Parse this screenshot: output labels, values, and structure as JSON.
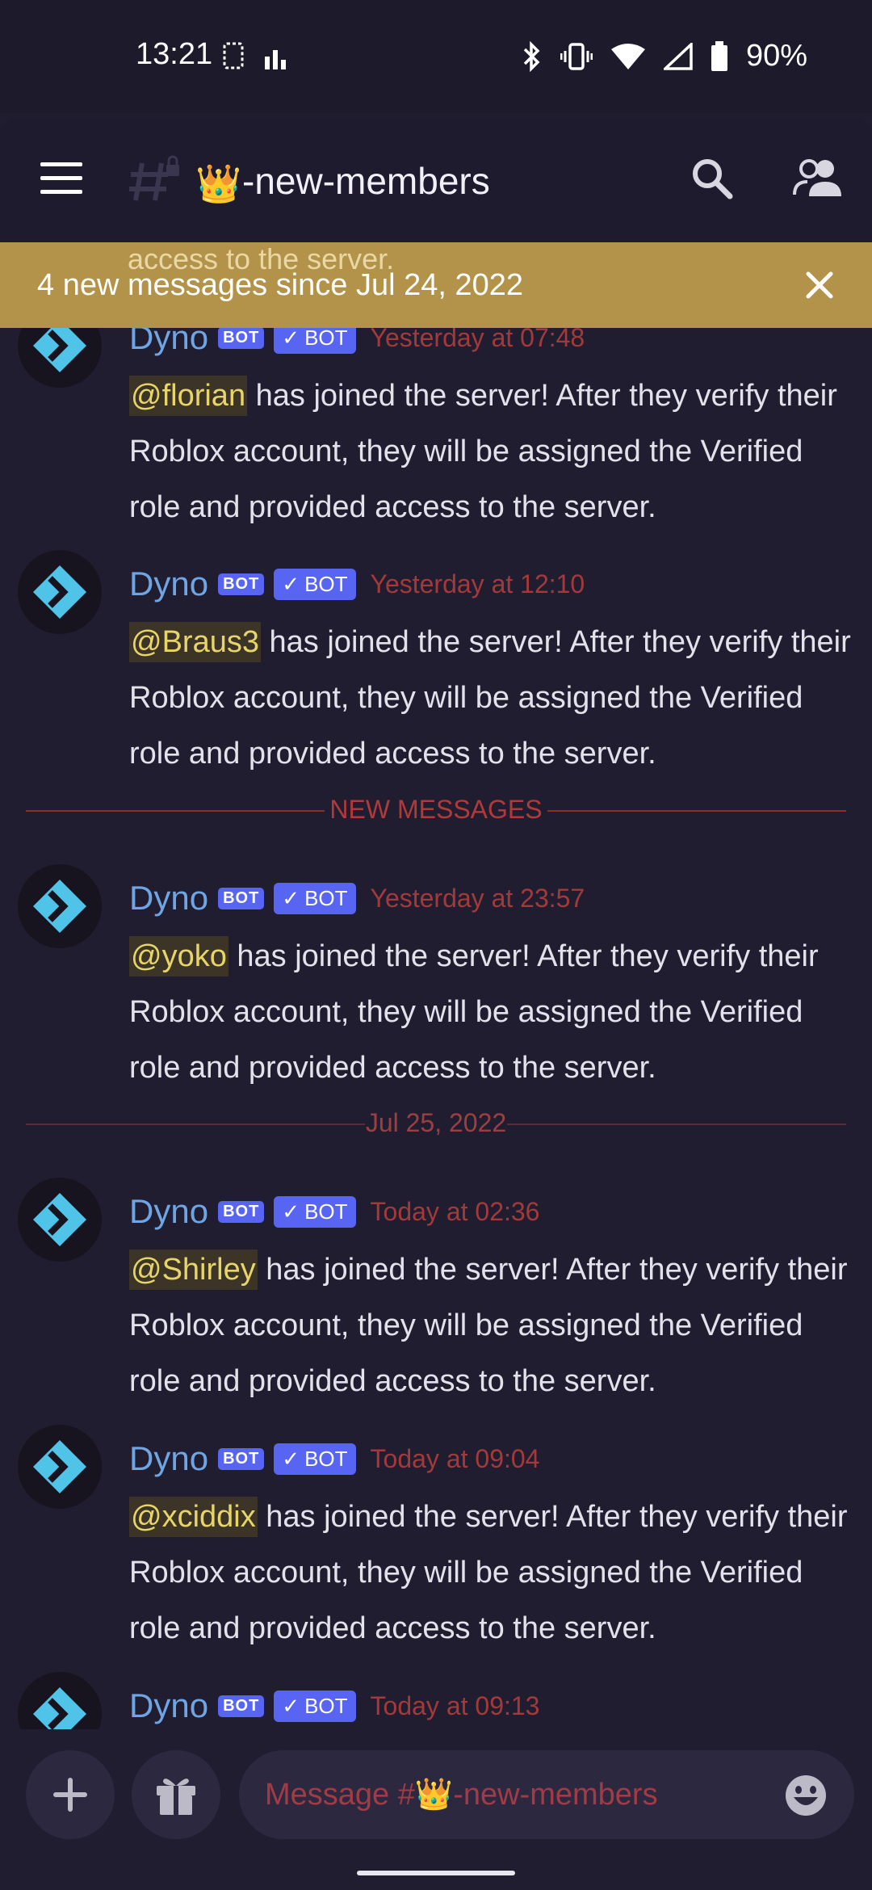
{
  "status_bar": {
    "time": "13:21",
    "battery": "90%"
  },
  "header": {
    "channel_emoji": "👑",
    "channel_name": "-new-members"
  },
  "banner": {
    "peek_text": "access to the server.",
    "text": "4 new messages since Jul 24, 2022"
  },
  "messages": [
    {
      "author": "Dyno",
      "bot_tag": "BOT",
      "verified_tag": "BOT",
      "time": "Yesterday at 07:48",
      "mention": "@florian",
      "body": " has joined the server! After they verify their Roblox account, they will be assigned the Verified role and provided access to the server."
    },
    {
      "author": "Dyno",
      "bot_tag": "BOT",
      "verified_tag": "BOT",
      "time": "Yesterday at 12:10",
      "mention": "@Braus3",
      "body": " has joined the server! After they verify their Roblox account, they will be assigned the Verified role and provided access to the server."
    },
    {
      "author": "Dyno",
      "bot_tag": "BOT",
      "verified_tag": "BOT",
      "time": "Yesterday at 23:57",
      "mention": "@yoko",
      "body": " has joined the server! After they verify their Roblox account, they will be assigned the Verified role and provided access to the server."
    },
    {
      "author": "Dyno",
      "bot_tag": "BOT",
      "verified_tag": "BOT",
      "time": "Today at 02:36",
      "mention": "@Shirley",
      "body": " has joined the server! After they verify their Roblox account, they will be assigned the Verified role and provided access to the server."
    },
    {
      "author": "Dyno",
      "bot_tag": "BOT",
      "verified_tag": "BOT",
      "time": "Today at 09:04",
      "mention": "@xciddix",
      "body": " has joined the server! After they verify their Roblox account, they will be assigned the Verified role and provided access to the server."
    },
    {
      "author": "Dyno",
      "bot_tag": "BOT",
      "verified_tag": "BOT",
      "time": "Today at 09:13"
    }
  ],
  "dividers": {
    "new_messages": "NEW MESSAGES",
    "date": "Jul 25, 2022"
  },
  "composer": {
    "placeholder": "Message #👑-new-members"
  },
  "icons": {
    "menu": "hamburger-icon",
    "channel": "hash-lock-icon",
    "search": "search-icon",
    "members": "members-icon",
    "close": "close-icon",
    "add": "plus-icon",
    "gift": "gift-icon",
    "emoji": "emoji-icon",
    "avatar": "dyno-logo-icon"
  },
  "colors": {
    "background": "#211d31",
    "banner": "#b39349",
    "mention": "#e8d56a",
    "author": "#6fa5e3",
    "timestamp": "#a23a3a",
    "bot_tag": "#5865f2",
    "new_divider": "#8e2c2c"
  }
}
